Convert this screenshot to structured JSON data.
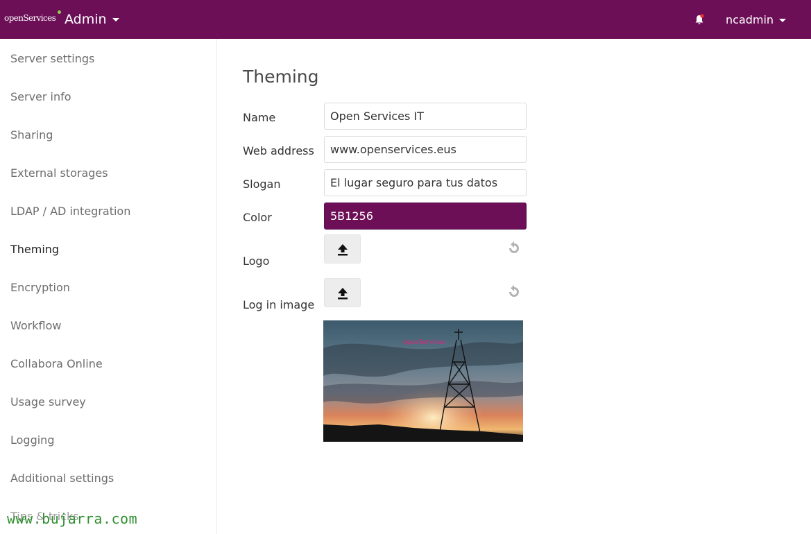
{
  "header": {
    "logo_text": "openServices",
    "app_menu_label": "Admin",
    "user_name": "ncadmin",
    "brand_color": "#6c0f57",
    "notification_icon": "bell-icon"
  },
  "sidebar": {
    "items": [
      {
        "label": "Server settings"
      },
      {
        "label": "Server info"
      },
      {
        "label": "Sharing"
      },
      {
        "label": "External storages"
      },
      {
        "label": "LDAP / AD integration"
      },
      {
        "label": "Theming",
        "active": true
      },
      {
        "label": "Encryption"
      },
      {
        "label": "Workflow"
      },
      {
        "label": "Collabora Online"
      },
      {
        "label": "Usage survey"
      },
      {
        "label": "Logging"
      },
      {
        "label": "Additional settings"
      },
      {
        "label": "Tips & tricks"
      }
    ]
  },
  "theming": {
    "title": "Theming",
    "name_label": "Name",
    "name_value": "Open Services IT",
    "web_label": "Web address",
    "web_value": "www.openservices.eus",
    "slogan_label": "Slogan",
    "slogan_value": "El lugar seguro para tus datos",
    "color_label": "Color",
    "color_value": "5B1256",
    "logo_label": "Logo",
    "login_image_label": "Log in image",
    "preview_logo_text": "openServices"
  },
  "watermark": "www.bujarra.com"
}
